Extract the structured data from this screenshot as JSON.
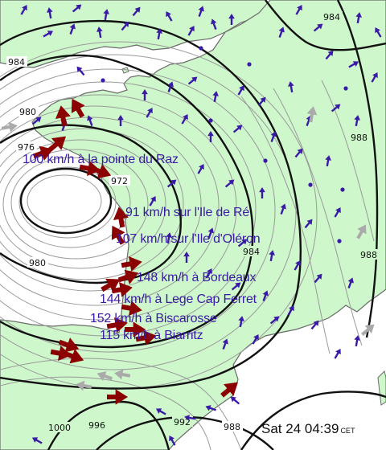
{
  "colors": {
    "land": "#cef7cb",
    "sea": "#ffffff",
    "coast": "#6b6b6b",
    "isobar_major": "#111111",
    "isobar_minor": "#9a9a9a",
    "arrow_blue": "#3a1aa6",
    "arrow_storm": "#8b0000",
    "arrow_grey": "#aaaaaa",
    "label_text": "#3a1aa6"
  },
  "pressure_labels": [
    "984",
    "984",
    "980",
    "976",
    "972",
    "980",
    "984",
    "988",
    "988",
    "996",
    "1000",
    "992",
    "988"
  ],
  "wind_reports": [
    "100 km/h à la pointe du Raz",
    "91 km/h sur l'Ile de Ré",
    "107 km/h sur l'Ile d'Oléron",
    "148 km/h à Bordeaux",
    "144 km/h à Lege Cap Ferret",
    "152 km/h à Biscarosse",
    "115 km/h à Biarritz"
  ],
  "timestamp": {
    "day": "Sat 24",
    "time": "04:39",
    "zone": "CET"
  },
  "icons": {
    "wind_arrow": "wind-arrow-icon",
    "storm_arrow": "storm-wind-arrow-icon",
    "station": "station-dot-icon"
  }
}
